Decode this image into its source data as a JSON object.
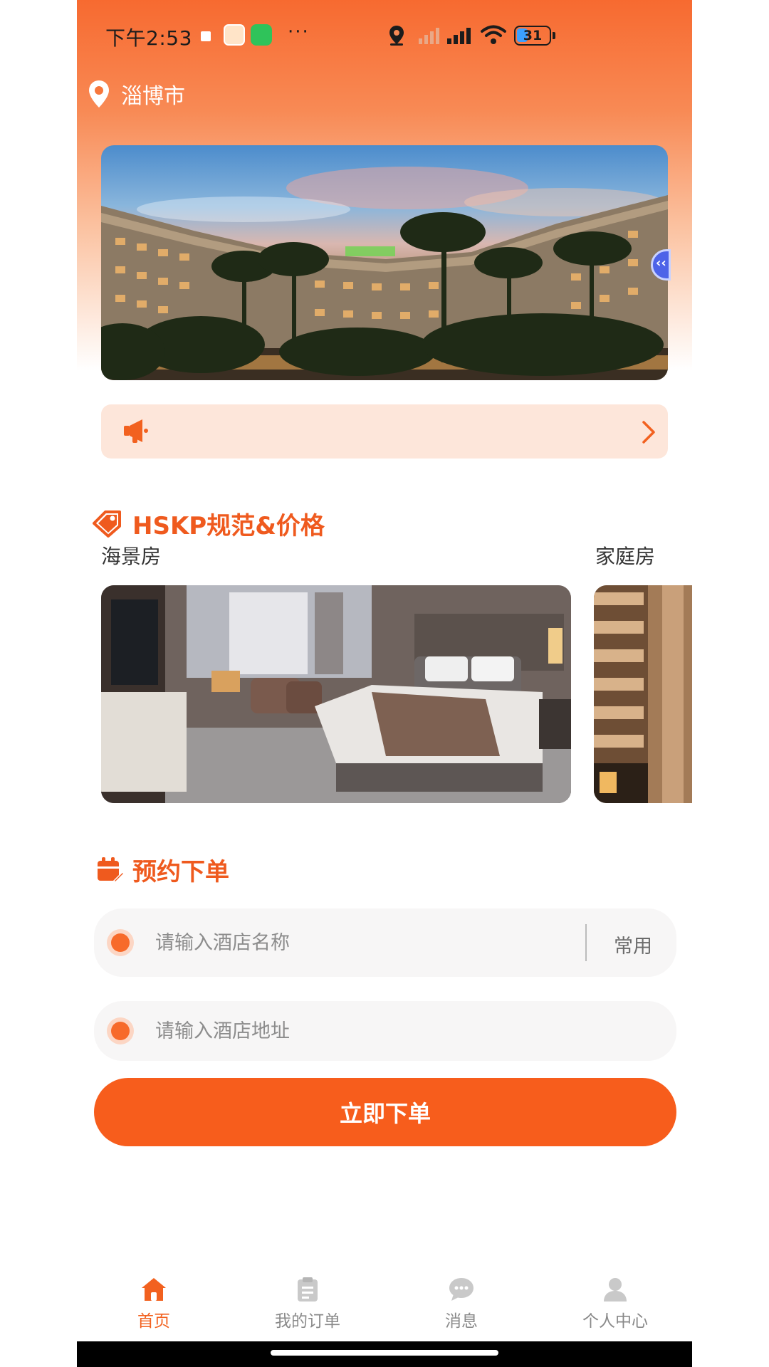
{
  "status_bar": {
    "time": "下午2:53",
    "more": "···",
    "battery": "31"
  },
  "location": {
    "city": "淄博市"
  },
  "notice": {
    "text": ""
  },
  "hskp": {
    "title": "HSKP规范&价格",
    "rooms": [
      {
        "label": "海景房"
      },
      {
        "label": "家庭房"
      }
    ]
  },
  "order": {
    "title": "预约下单",
    "hotel_name_placeholder": "请输入酒店名称",
    "hotel_name_value": "",
    "common_label": "常用",
    "hotel_address_placeholder": "请输入酒店地址",
    "hotel_address_value": "",
    "submit_label": "立即下单"
  },
  "tabbar": {
    "tabs": [
      {
        "label": "首页",
        "icon": "home-icon",
        "active": true
      },
      {
        "label": "我的订单",
        "icon": "clipboard-icon",
        "active": false
      },
      {
        "label": "消息",
        "icon": "chat-bubble-icon",
        "active": false
      },
      {
        "label": "个人中心",
        "icon": "user-icon",
        "active": false
      }
    ]
  },
  "colors": {
    "accent": "#f75d1c",
    "header_gradient_top": "#f76a30",
    "notice_bg": "#fde6da",
    "tab_inactive": "#8a8a8a"
  }
}
